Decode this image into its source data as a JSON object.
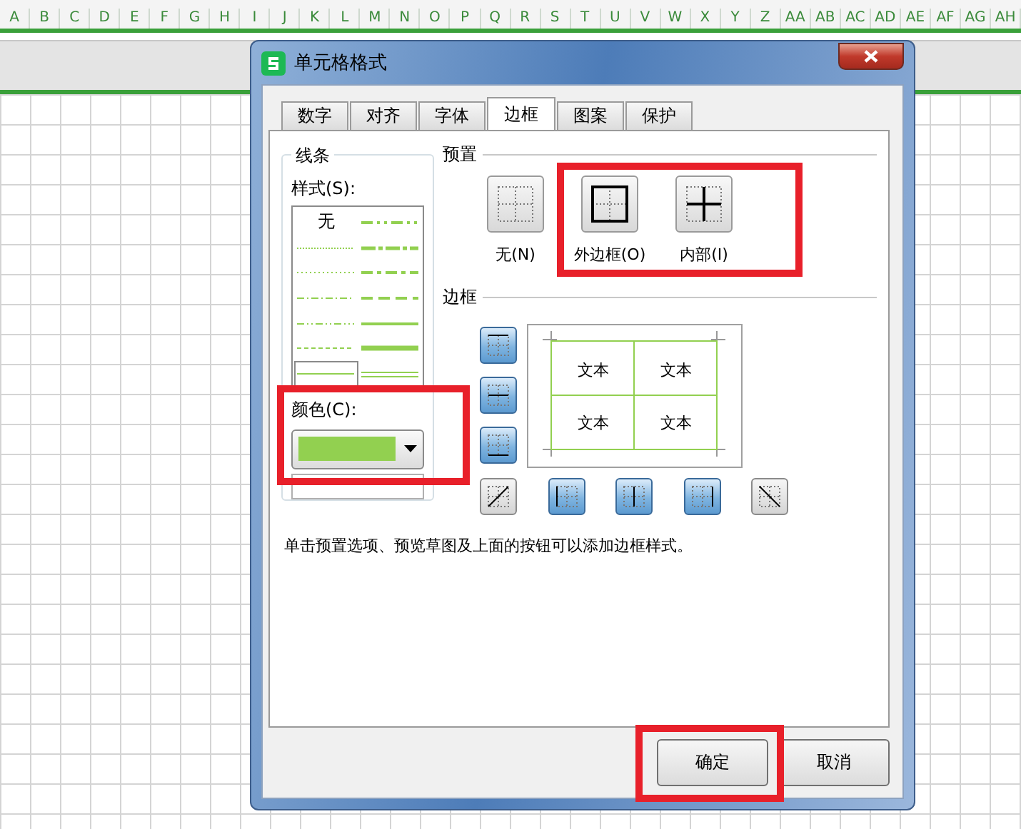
{
  "column_headers": [
    "A",
    "B",
    "C",
    "D",
    "E",
    "F",
    "G",
    "H",
    "I",
    "J",
    "K",
    "L",
    "M",
    "N",
    "O",
    "P",
    "Q",
    "R",
    "S",
    "T",
    "U",
    "V",
    "W",
    "X",
    "Y",
    "Z",
    "AA",
    "AB",
    "AC",
    "AD",
    "AE",
    "AF",
    "AG",
    "AH"
  ],
  "dialog": {
    "title": "单元格格式",
    "tabs": [
      {
        "label": "数字",
        "selected": false
      },
      {
        "label": "对齐",
        "selected": false
      },
      {
        "label": "字体",
        "selected": false
      },
      {
        "label": "边框",
        "selected": true
      },
      {
        "label": "图案",
        "selected": false
      },
      {
        "label": "保护",
        "selected": false
      }
    ],
    "line_group": {
      "title": "线条",
      "style_label": "样式(S):",
      "styles": [
        {
          "kind": "none",
          "label": "无",
          "selected": false
        },
        {
          "kind": "hair",
          "selected": false
        },
        {
          "kind": "dotted",
          "selected": false
        },
        {
          "kind": "dash-dot",
          "selected": false
        },
        {
          "kind": "dash-dot-dot",
          "selected": false
        },
        {
          "kind": "dashed",
          "selected": false
        },
        {
          "kind": "thin",
          "selected": true
        },
        {
          "kind": "medium-dash-dot-dot",
          "selected": false
        },
        {
          "kind": "slant-dash-dot",
          "selected": false
        },
        {
          "kind": "medium-dash-dot",
          "selected": false
        },
        {
          "kind": "medium-dashed",
          "selected": false
        },
        {
          "kind": "medium",
          "selected": false
        },
        {
          "kind": "thick",
          "selected": false
        },
        {
          "kind": "double",
          "selected": false
        }
      ],
      "color_label": "颜色(C):",
      "color": "#92d050"
    },
    "presets": {
      "title": "预置",
      "items": [
        {
          "kind": "none",
          "label": "无(N)"
        },
        {
          "kind": "outline",
          "label": "外边框(O)"
        },
        {
          "kind": "inside",
          "label": "内部(I)"
        }
      ]
    },
    "border": {
      "title": "边框",
      "side_buttons": [
        {
          "kind": "top",
          "on": true
        },
        {
          "kind": "middle",
          "on": true
        },
        {
          "kind": "bottom",
          "on": true
        }
      ],
      "bottom_buttons": [
        {
          "kind": "diag-up",
          "on": false
        },
        {
          "kind": "left",
          "on": true
        },
        {
          "kind": "center",
          "on": true
        },
        {
          "kind": "right",
          "on": true
        },
        {
          "kind": "diag-down",
          "on": false
        }
      ],
      "preview_texts": [
        "文本",
        "文本",
        "文本",
        "文本"
      ]
    },
    "hint": "单击预置选项、预览草图及上面的按钮可以添加边框样式。",
    "buttons": [
      {
        "label": "确定"
      },
      {
        "label": "取消"
      }
    ]
  }
}
